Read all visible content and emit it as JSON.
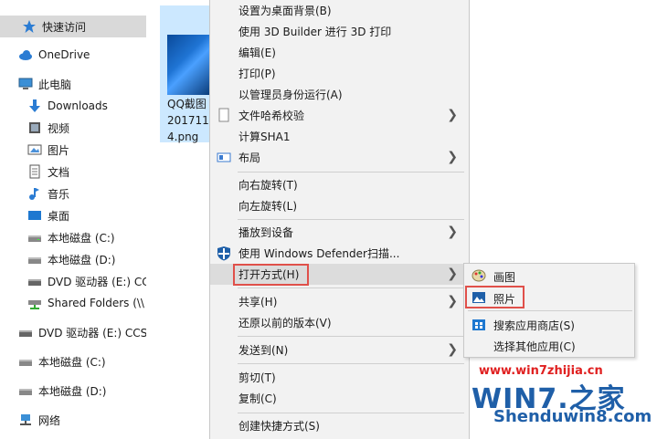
{
  "sidebar": {
    "items": [
      {
        "label": "快速访问",
        "icon": "star-icon"
      },
      {
        "label": "OneDrive",
        "icon": "cloud-icon"
      },
      {
        "label": "此电脑",
        "icon": "computer-icon"
      },
      {
        "label": "Downloads",
        "icon": "download-arrow-icon"
      },
      {
        "label": "视频",
        "icon": "video-icon"
      },
      {
        "label": "图片",
        "icon": "picture-icon"
      },
      {
        "label": "文档",
        "icon": "document-icon"
      },
      {
        "label": "音乐",
        "icon": "music-note-icon"
      },
      {
        "label": "桌面",
        "icon": "desktop-icon"
      },
      {
        "label": "本地磁盘 (C:)",
        "icon": "drive-icon"
      },
      {
        "label": "本地磁盘 (D:)",
        "icon": "drive-icon"
      },
      {
        "label": "DVD 驱动器 (E:) CC",
        "icon": "dvd-icon"
      },
      {
        "label": "Shared Folders (\\\\",
        "icon": "network-drive-icon"
      },
      {
        "label": "DVD 驱动器 (E:) CCS",
        "icon": "dvd-icon"
      },
      {
        "label": "本地磁盘 (C:)",
        "icon": "drive-icon"
      },
      {
        "label": "本地磁盘 (D:)",
        "icon": "drive-icon"
      },
      {
        "label": "网络",
        "icon": "network-icon"
      }
    ]
  },
  "file": {
    "name_line1": "QQ截图",
    "name_line2": "201711",
    "name_line3": "4.png"
  },
  "context_menu": {
    "items": [
      {
        "label": "设置为桌面背景(B)"
      },
      {
        "label": "使用 3D Builder 进行 3D 打印"
      },
      {
        "label": "编辑(E)"
      },
      {
        "label": "打印(P)"
      },
      {
        "label": "以管理员身份运行(A)"
      },
      {
        "label": "文件哈希校验"
      },
      {
        "label": "计算SHA1"
      },
      {
        "label": "布局"
      },
      {
        "label": "向右旋转(T)"
      },
      {
        "label": "向左旋转(L)"
      },
      {
        "label": "播放到设备"
      },
      {
        "label": "使用 Windows Defender扫描..."
      },
      {
        "label": "打开方式(H)"
      },
      {
        "label": "共享(H)"
      },
      {
        "label": "还原以前的版本(V)"
      },
      {
        "label": "发送到(N)"
      },
      {
        "label": "剪切(T)"
      },
      {
        "label": "复制(C)"
      },
      {
        "label": "创建快捷方式(S)"
      }
    ]
  },
  "submenu": {
    "items": [
      {
        "label": "画图",
        "icon": "paint-palette-icon"
      },
      {
        "label": "照片",
        "icon": "photos-icon"
      },
      {
        "label": "搜索应用商店(S)",
        "icon": "store-icon"
      },
      {
        "label": "选择其他应用(C)"
      }
    ]
  },
  "watermark": {
    "url": "www.win7zhijia.cn",
    "logo": "WIN7.之家",
    "sub": "Shenduwin8.com"
  },
  "colors": {
    "highlight_box": "#e0504a",
    "selection_tile": "#cce8ff",
    "menu_bg": "#f2f2f2"
  }
}
